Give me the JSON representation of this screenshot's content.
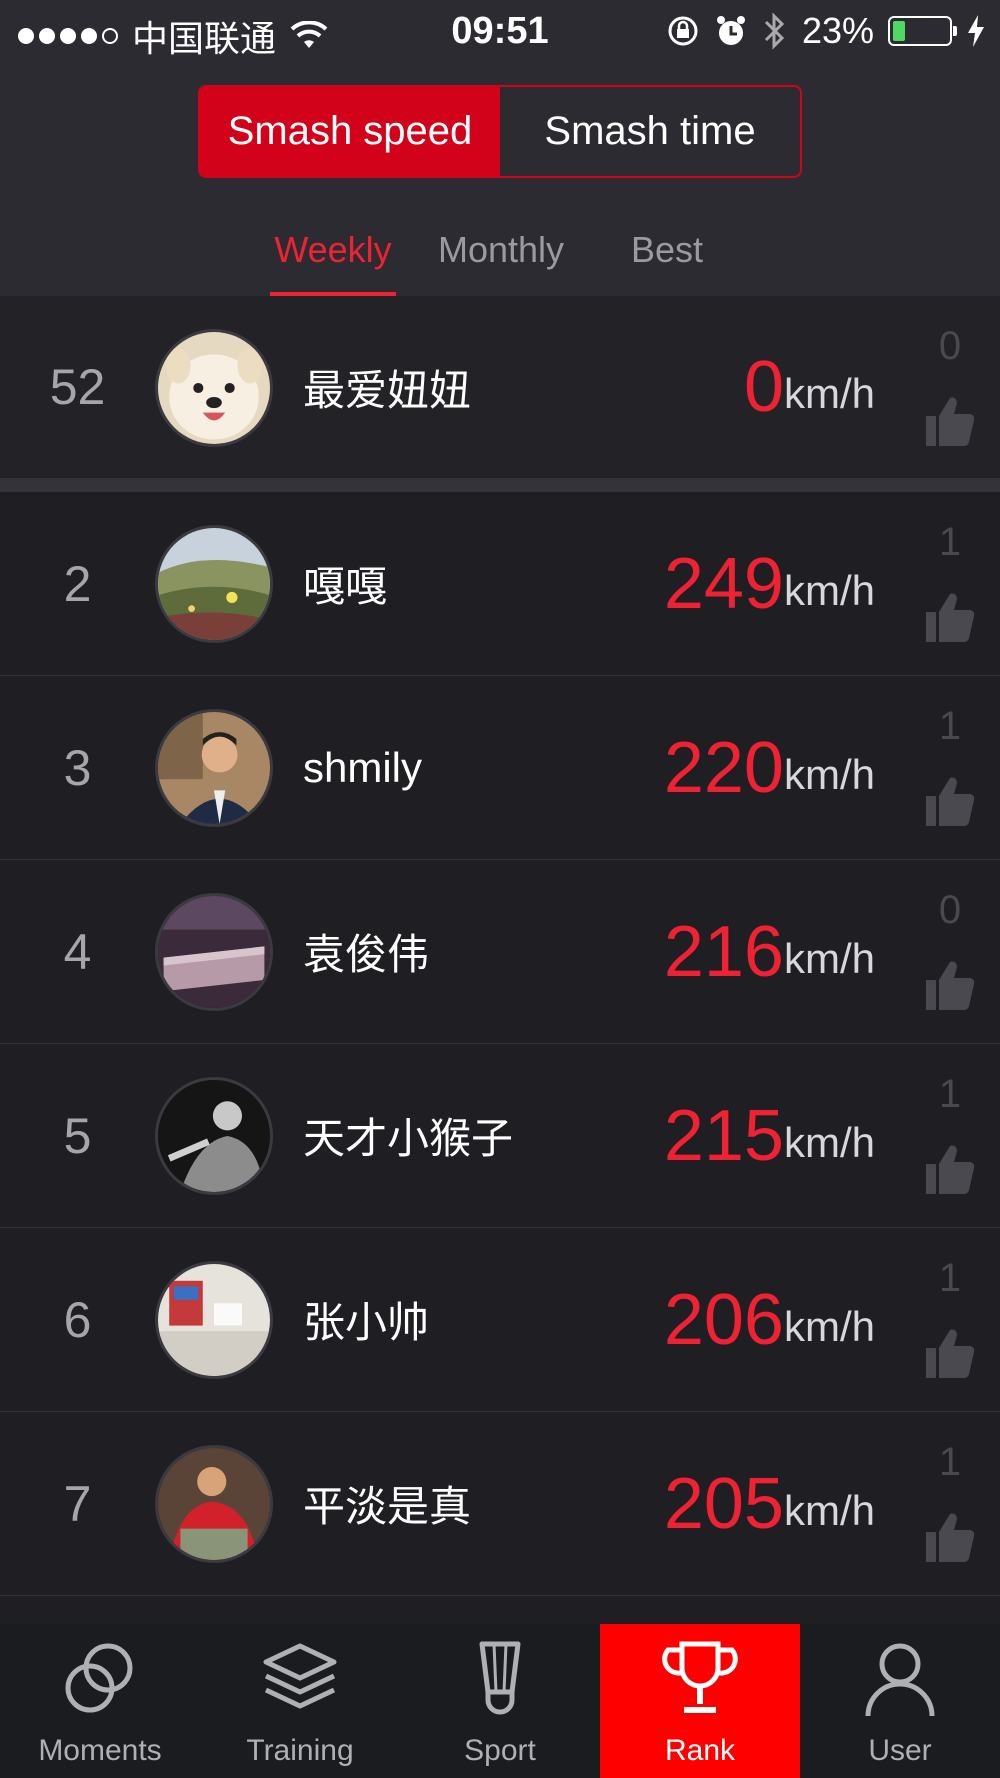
{
  "status_bar": {
    "carrier": "中国联通",
    "time": "09:51",
    "battery_percent": "23%",
    "battery_level": 0.23
  },
  "segment": {
    "options": [
      "Smash speed",
      "Smash time"
    ],
    "selected": "Smash speed"
  },
  "period_tabs": {
    "items": [
      "Weekly",
      "Monthly",
      "Best"
    ],
    "selected": "Weekly"
  },
  "speed_unit": "km/h",
  "my_rank": {
    "rank": "52",
    "name": "最爱妞妞",
    "speed": "0",
    "likes": "0"
  },
  "rankings": [
    {
      "rank": "2",
      "name": "嘎嘎",
      "speed": "249",
      "likes": "1"
    },
    {
      "rank": "3",
      "name": "shmily",
      "speed": "220",
      "likes": "1"
    },
    {
      "rank": "4",
      "name": "袁俊伟",
      "speed": "216",
      "likes": "0"
    },
    {
      "rank": "5",
      "name": "天才小猴子",
      "speed": "215",
      "likes": "1"
    },
    {
      "rank": "6",
      "name": "张小帅",
      "speed": "206",
      "likes": "1"
    },
    {
      "rank": "7",
      "name": "平淡是真",
      "speed": "205",
      "likes": "1"
    }
  ],
  "tab_bar": {
    "items": [
      {
        "label": "Moments",
        "icon": "moments-icon"
      },
      {
        "label": "Training",
        "icon": "layers-icon"
      },
      {
        "label": "Sport",
        "icon": "shuttlecock-icon"
      },
      {
        "label": "Rank",
        "icon": "trophy-icon"
      },
      {
        "label": "User",
        "icon": "user-icon"
      }
    ],
    "selected": "Rank"
  },
  "colors": {
    "accent": "#ee2233",
    "segment_active": "#d2021b",
    "tab_active": "#ff0000",
    "background": "#1f1e23"
  }
}
